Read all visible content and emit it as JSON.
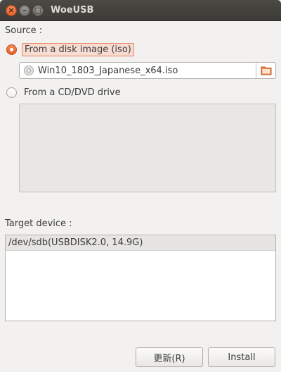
{
  "window": {
    "title": "WoeUSB",
    "close_glyph": "×",
    "min_glyph": "–",
    "max_glyph": "□"
  },
  "source": {
    "label": "Source :",
    "option_iso": {
      "label": "From a disk image (iso)",
      "selected": true
    },
    "iso_file": "Win10_1803_Japanese_x64.iso",
    "option_drive": {
      "label": "From a CD/DVD drive",
      "selected": false
    },
    "drives": []
  },
  "target": {
    "label": "Target device :",
    "devices": [
      "/dev/sdb(USBDISK2.0, 14.9G)"
    ]
  },
  "buttons": {
    "refresh_label": "更新(R)",
    "install_label": "Install"
  },
  "colors": {
    "accent": "#e65d25",
    "titlebar": "#3c3b37"
  },
  "icons": {
    "iso_file": "disc-icon",
    "browse": "folder-icon"
  }
}
